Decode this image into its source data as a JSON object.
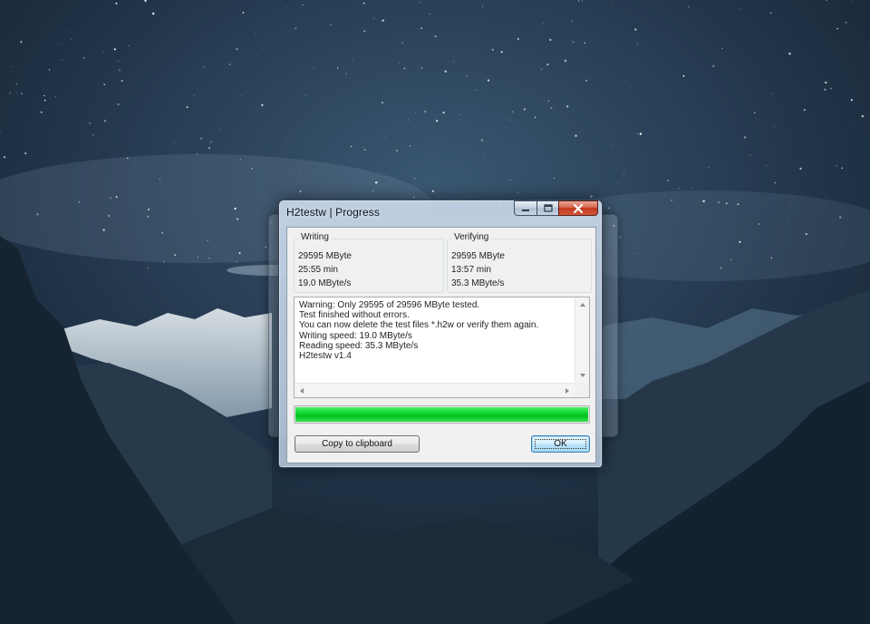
{
  "window": {
    "title": "H2testw | Progress"
  },
  "writing": {
    "label": "Writing",
    "size": "29595 MByte",
    "time": "25:55 min",
    "speed": "19.0 MByte/s"
  },
  "verifying": {
    "label": "Verifying",
    "size": "29595 MByte",
    "time": "13:57 min",
    "speed": "35.3 MByte/s"
  },
  "log": {
    "lines": [
      "Warning: Only 29595 of 29596 MByte tested.",
      "Test finished without errors.",
      "You can now delete the test files *.h2w or verify them again.",
      "Writing speed: 19.0 MByte/s",
      "Reading speed: 35.3 MByte/s",
      "H2testw v1.4"
    ]
  },
  "progress": {
    "fraction": 1.0,
    "color": "#0ed530"
  },
  "buttons": {
    "copy_label": "Copy to clipboard",
    "ok_label": "OK"
  },
  "icons": {
    "minimize": "minimize-icon",
    "maximize": "maximize-icon",
    "close": "close-icon"
  }
}
